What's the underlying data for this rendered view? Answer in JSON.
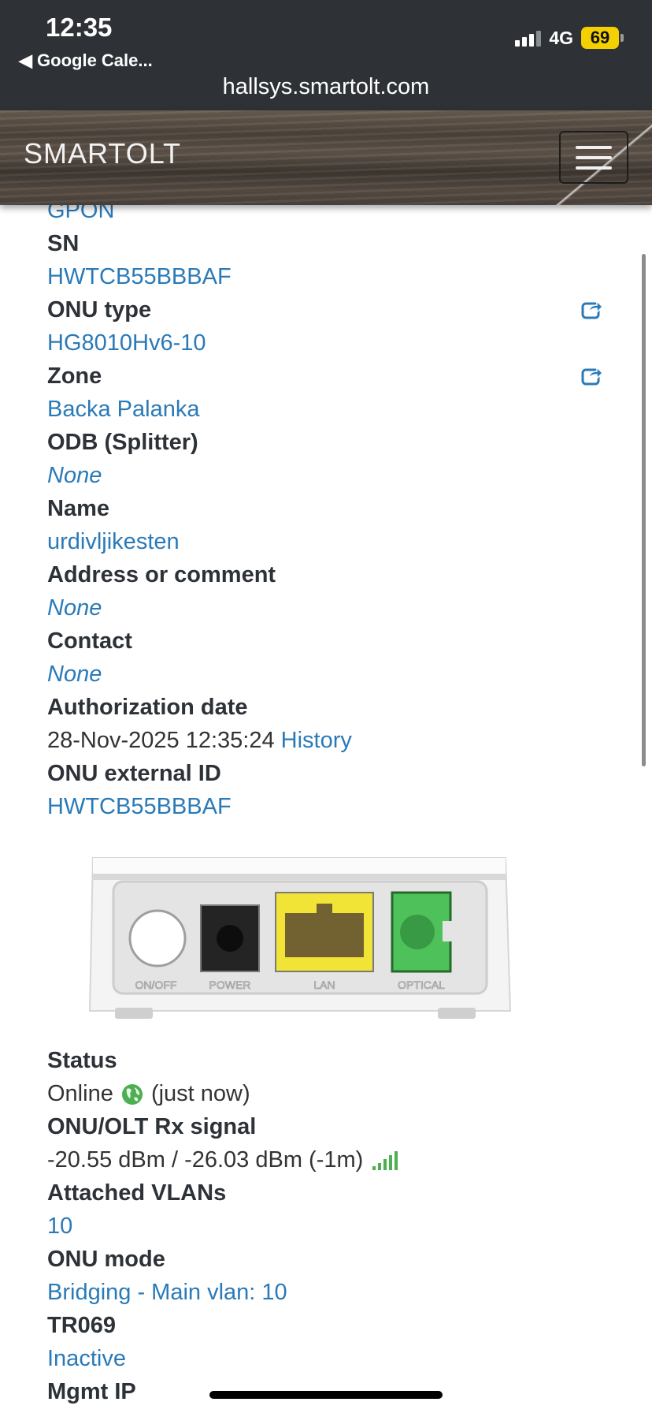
{
  "status_bar": {
    "time": "12:35",
    "back_app": "◀ Google Cale...",
    "network": "4G",
    "battery": "69",
    "url": "hallsys.smartolt.com"
  },
  "navbar": {
    "brand": "SMARTOLT"
  },
  "details": {
    "pon_type": "GPON",
    "sn_label": "SN",
    "sn_value": "HWTCB55BBBAF",
    "onu_type_label": "ONU type",
    "onu_type_value": "HG8010Hv6-10",
    "zone_label": "Zone",
    "zone_value": "Backa Palanka",
    "odb_label": "ODB (Splitter)",
    "odb_value": "None",
    "name_label": "Name",
    "name_value": "urdivljikesten",
    "address_label": "Address or comment",
    "address_value": "None",
    "contact_label": "Contact",
    "contact_value": "None",
    "auth_date_label": "Authorization date",
    "auth_date_value": "28-Nov-2025 12:35:24",
    "history_link": "History",
    "external_id_label": "ONU external ID",
    "external_id_value": "HWTCB55BBBAF"
  },
  "device_ports": {
    "on_off": "ON/OFF",
    "power": "POWER",
    "lan": "LAN",
    "optical": "OPTICAL"
  },
  "status": {
    "status_label": "Status",
    "status_value": "Online",
    "status_time": "(just now)",
    "rx_label": "ONU/OLT Rx signal",
    "rx_value": "-20.55 dBm / -26.03 dBm (-1m)",
    "vlans_label": "Attached VLANs",
    "vlans_value": "10",
    "mode_label": "ONU mode",
    "mode_value": "Bridging - Main vlan: 10",
    "tr069_label": "TR069",
    "tr069_value": "Inactive",
    "mgmt_ip_label": "Mgmt IP"
  },
  "colors": {
    "link": "#2a7ab8",
    "label": "#2d3238",
    "online": "#4caf50"
  }
}
